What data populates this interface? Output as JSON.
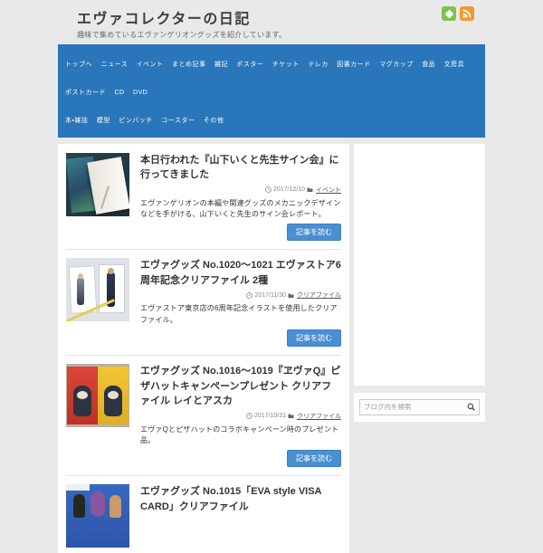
{
  "colors": {
    "page_bg": "#e9e9e9",
    "nav_bg": "#2a76ba",
    "button_bg": "#4a8fd1",
    "feedly_green": "#7ec14b",
    "rss_orange": "#f39a2b"
  },
  "header": {
    "title": "エヴァコレクターの日記",
    "subtitle": "趣味で集めているエヴァンゲリオングッズを紹介しています。",
    "icons": [
      "feedly-icon",
      "rss-icon"
    ]
  },
  "nav": {
    "items": [
      "トップへ",
      "ニュース",
      "イベント",
      "まとめ記事",
      "雑記",
      "ポスター",
      "チケット",
      "テレカ",
      "図書カード",
      "マグカップ",
      "食品",
      "文房具",
      "ポストカード",
      "CD",
      "DVD",
      "本・雑誌",
      "模型",
      "ピンバッチ",
      "コースター",
      "その他"
    ]
  },
  "articles": [
    {
      "title": "本日行われた『山下いくと先生サイン会』に行ってきました",
      "date": "2017/12/10",
      "category": "イベント",
      "excerpt": "エヴァンゲリオンの本編や関連グッズのメカニックデザインなどを手がける、山下いくと先生のサイン会レポート。",
      "read_more": "記事を読む"
    },
    {
      "title": "エヴァグッズ No.1020～1021 エヴァストア6周年記念クリアファイル 2種",
      "date": "2017/11/30",
      "category": "クリアファイル",
      "excerpt": "エヴァストア東京店の6周年記念イラストを使用したクリアファイル。",
      "read_more": "記事を読む"
    },
    {
      "title": "エヴァグッズ No.1016～1019『ヱヴァQ』ピザハットキャンペーンプレゼント クリアファイル レイとアスカ",
      "date": "2017/10/31",
      "category": "クリアファイル",
      "excerpt": "エヴァQとピザハットのコラボキャンペーン時のプレゼント品。",
      "read_more": "記事を読む"
    },
    {
      "title": "エヴァグッズ No.1015「EVA style VISA CARD」クリアファイル"
    }
  ],
  "sidebar": {
    "search_placeholder": "ブログ内を検索"
  }
}
